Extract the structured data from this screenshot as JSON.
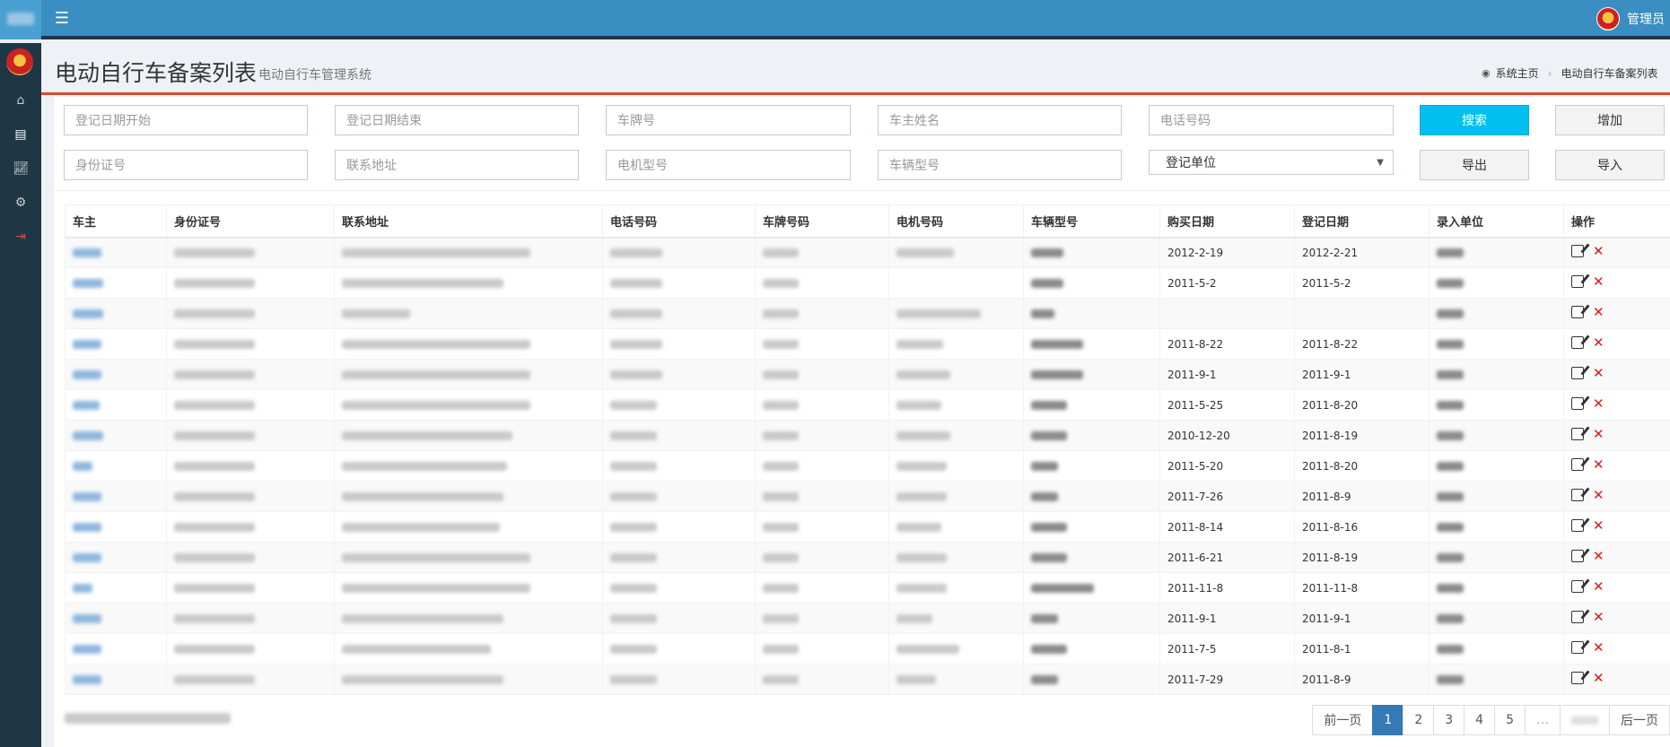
{
  "user": {
    "name": "管理员"
  },
  "page": {
    "title": "电动自行车备案列表",
    "subtitle": "电动自行车管理系统"
  },
  "breadcrumb": {
    "home": "系统主页",
    "current": "电动自行车备案列表"
  },
  "search": {
    "reg_date_start": "登记日期开始",
    "reg_date_end": "登记日期结束",
    "plate_no": "车牌号",
    "owner_name": "车主姓名",
    "phone": "电话号码",
    "id_no": "身份证号",
    "address": "联系地址",
    "motor_model": "电机型号",
    "vehicle_model": "车辆型号",
    "reg_unit": "登记单位"
  },
  "buttons": {
    "search": "搜索",
    "add": "增加",
    "export": "导出",
    "import": "导入"
  },
  "table": {
    "headers": [
      "车主",
      "身份证号",
      "联系地址",
      "电话号码",
      "车牌号码",
      "电机号码",
      "车辆型号",
      "购买日期",
      "登记日期",
      "录入单位",
      "操作"
    ],
    "rows": [
      {
        "purchase_date": "2012-2-19",
        "reg_date": "2012-2-21"
      },
      {
        "purchase_date": "2011-5-2",
        "reg_date": "2011-5-2"
      },
      {
        "purchase_date": "",
        "reg_date": ""
      },
      {
        "purchase_date": "2011-8-22",
        "reg_date": "2011-8-22"
      },
      {
        "purchase_date": "2011-9-1",
        "reg_date": "2011-9-1"
      },
      {
        "purchase_date": "2011-5-25",
        "reg_date": "2011-8-20"
      },
      {
        "purchase_date": "2010-12-20",
        "reg_date": "2011-8-19"
      },
      {
        "purchase_date": "2011-5-20",
        "reg_date": "2011-8-20"
      },
      {
        "purchase_date": "2011-7-26",
        "reg_date": "2011-8-9"
      },
      {
        "purchase_date": "2011-8-14",
        "reg_date": "2011-8-16"
      },
      {
        "purchase_date": "2011-6-21",
        "reg_date": "2011-8-19"
      },
      {
        "purchase_date": "2011-11-8",
        "reg_date": "2011-11-8"
      },
      {
        "purchase_date": "2011-9-1",
        "reg_date": "2011-9-1"
      },
      {
        "purchase_date": "2011-7-5",
        "reg_date": "2011-8-1"
      },
      {
        "purchase_date": "2011-7-29",
        "reg_date": "2011-8-9"
      }
    ]
  },
  "pagination": {
    "prev": "前一页",
    "pages": [
      "1",
      "2",
      "3",
      "4",
      "5"
    ],
    "active": "1",
    "ellipsis": "…",
    "next": "后一页"
  }
}
